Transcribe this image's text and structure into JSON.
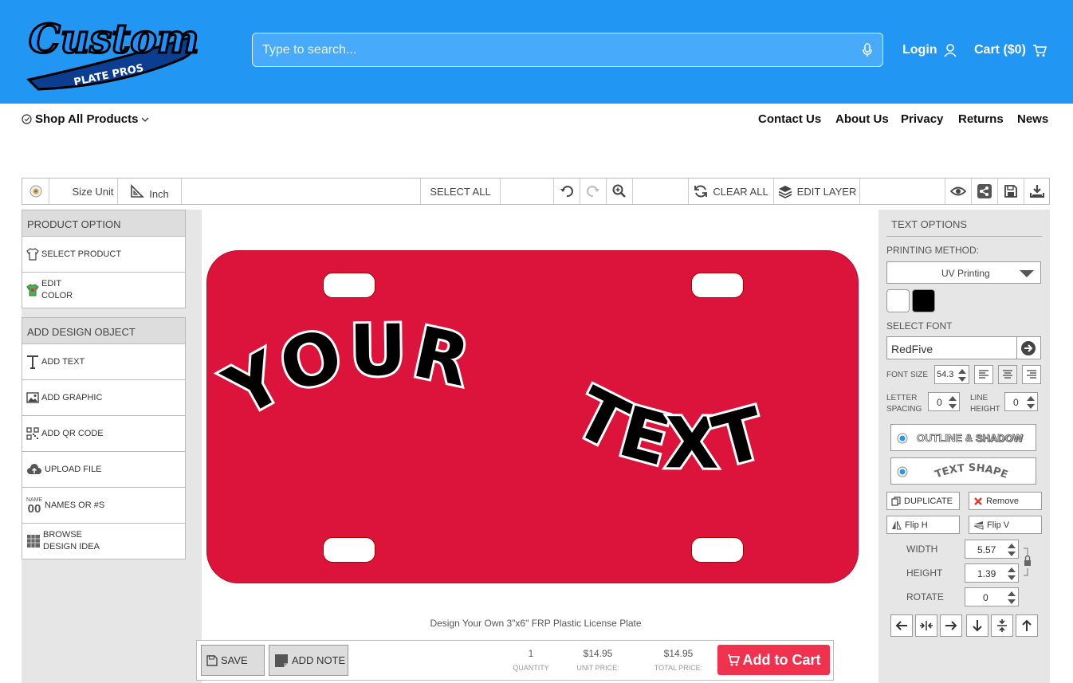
{
  "header": {
    "logo_text": "Custom",
    "logo_sub": "PLATE PROS",
    "search_placeholder": "Type to search...",
    "login_label": "Login",
    "cart_label": "Cart ($0)"
  },
  "nav": {
    "shop_all": "Shop All Products",
    "links": [
      "Contact Us",
      "About Us",
      "Privacy",
      "Returns",
      "News"
    ]
  },
  "toolbar": {
    "size_unit_label": "Size Unit",
    "unit_value": "Inch",
    "select_all": "SELECT ALL",
    "clear_all": "CLEAR ALL",
    "edit_layer": "EDIT LAYER"
  },
  "left_panel": {
    "product_option_title": "PRODUCT OPTION",
    "select_product": "SELECT PRODUCT",
    "edit_color_1": "EDIT",
    "edit_color_2": "COLOR",
    "add_design_title": "ADD DESIGN OBJECT",
    "add_text": "ADD TEXT",
    "add_graphic": "ADD GRAPHIC",
    "add_qr": "ADD QR CODE",
    "upload_file": "UPLOAD FILE",
    "names_icon_top": "NAME",
    "names_icon_num": "00",
    "names": "NAMES OR #S",
    "browse_1": "BROWSE",
    "browse_2": "DESIGN IDEA"
  },
  "canvas": {
    "plate_color": "#dc143c",
    "text_line1": "YOUR",
    "text_line2": "TEXT",
    "caption": "Design Your Own 3\"x6\" FRP Plastic License Plate"
  },
  "bottom_bar": {
    "save": "SAVE",
    "add_note": "ADD NOTE",
    "quantity_value": "1",
    "quantity_label": "QUANTITY",
    "unit_price_value": "$14.95",
    "unit_price_label": "UNIT PRICE:",
    "total_price_value": "$14.95",
    "total_price_label": "TOTAL PRICE:",
    "add_to_cart": "Add to Cart"
  },
  "right_panel": {
    "title": "TEXT OPTIONS",
    "printing_method_label": "PRINTING METHOD:",
    "printing_method_value": "UV Printing",
    "swatch_colors": [
      "#ffffff",
      "#000000"
    ],
    "select_font_label": "SELECT FONT",
    "font_value": "RedFive",
    "font_size_label": "FONT SIZE",
    "font_size_value": "54.3",
    "letter_spacing_label_1": "LETTER",
    "letter_spacing_label_2": "SPACING",
    "letter_spacing_value": "0",
    "line_height_label_1": "LINE",
    "line_height_label_2": "HEIGHT",
    "line_height_value": "0",
    "outline_shadow_1": "OUTLINE &",
    "outline_shadow_2": "SHADOW",
    "text_shape": "TEXT SHAPE",
    "duplicate": "DUPLICATE",
    "remove": "Remove",
    "flip_h": "Flip H",
    "flip_v": "Flip V",
    "width_label": "WIDTH",
    "width_value": "5.57",
    "height_label": "HEIGHT",
    "height_value": "1.39",
    "rotate_label": "ROTATE",
    "rotate_value": "0"
  }
}
